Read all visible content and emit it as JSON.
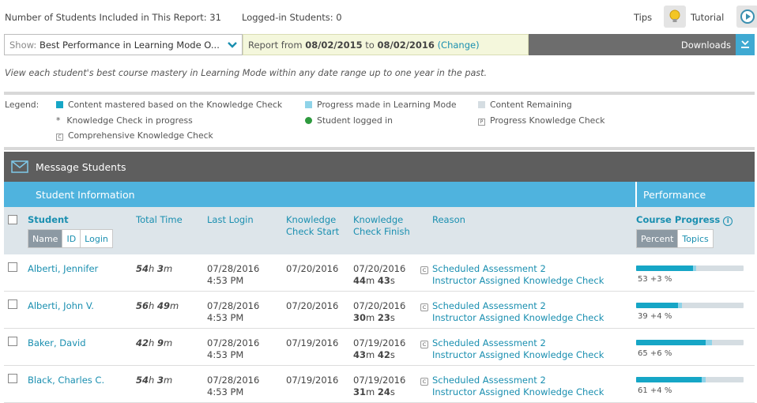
{
  "topbar": {
    "students_included": "Number of Students Included in This Report: 31",
    "logged_in": "Logged-in Students: 0",
    "tips_label": "Tips",
    "tutorial_label": "Tutorial"
  },
  "showbar": {
    "show_label": "Show:",
    "show_value": "Best Performance in Learning Mode O...",
    "report_prefix": "Report from",
    "date_from": "08/02/2015",
    "date_to_word": "to",
    "date_to": "08/02/2016",
    "change_label": "(Change)",
    "downloads_label": "Downloads"
  },
  "description": "View each student's best course mastery in Learning Mode within any date range up to one year in the past.",
  "legend": {
    "title": "Legend:",
    "mastered": "Content mastered based on the Knowledge Check",
    "progress": "Progress made in Learning Mode",
    "remaining": "Content Remaining",
    "in_progress_marker": "*",
    "in_progress": "Knowledge Check in progress",
    "logged_in": "Student logged in",
    "progress_kc_marker": "P",
    "progress_kc": "Progress Knowledge Check",
    "comprehensive_marker": "C",
    "comprehensive": "Comprehensive Knowledge Check"
  },
  "colors": {
    "mastered": "#16a6c6",
    "progress": "#8fd3e8",
    "remaining": "#d5dde2",
    "logged_in": "#2e9a3e"
  },
  "message_bar": {
    "label": "Message Students"
  },
  "header": {
    "student_info": "Student Information",
    "performance": "Performance"
  },
  "columns": {
    "student": "Student",
    "sort_name": "Name",
    "sort_id": "ID",
    "sort_login": "Login",
    "total_time": "Total Time",
    "last_login": "Last Login",
    "kc_start_1": "Knowledge",
    "kc_start_2": "Check Start",
    "kc_finish_1": "Knowledge",
    "kc_finish_2": "Check Finish",
    "reason": "Reason",
    "course_progress": "Course Progress",
    "view_percent": "Percent",
    "view_topics": "Topics"
  },
  "rows": [
    {
      "name": "Alberti, Jennifer",
      "time_h": "54",
      "time_m": "3",
      "last_login_date": "07/28/2016",
      "last_login_time": "4:53 PM",
      "kc_start": "07/20/2016",
      "kc_finish_date": "07/20/2016",
      "kc_finish_m": "44",
      "kc_finish_s": "43",
      "badge": "C",
      "reason1": "Scheduled Assessment 2",
      "reason2": "Instructor Assigned Knowledge Check",
      "progress_text": "53 +3 %",
      "mastered": 53,
      "progress": 3
    },
    {
      "name": "Alberti, John V.",
      "time_h": "56",
      "time_m": "49",
      "last_login_date": "07/28/2016",
      "last_login_time": "4:53 PM",
      "kc_start": "07/20/2016",
      "kc_finish_date": "07/20/2016",
      "kc_finish_m": "30",
      "kc_finish_s": "23",
      "badge": "C",
      "reason1": "Scheduled Assessment 2",
      "reason2": "Instructor Assigned Knowledge Check",
      "progress_text": "39 +4 %",
      "mastered": 39,
      "progress": 4
    },
    {
      "name": "Baker, David",
      "time_h": "42",
      "time_m": "9",
      "last_login_date": "07/28/2016",
      "last_login_time": "4:53 PM",
      "kc_start": "07/19/2016",
      "kc_finish_date": "07/19/2016",
      "kc_finish_m": "43",
      "kc_finish_s": "42",
      "badge": "C",
      "reason1": "Scheduled Assessment 2",
      "reason2": "Instructor Assigned Knowledge Check",
      "progress_text": "65 +6 %",
      "mastered": 65,
      "progress": 6
    },
    {
      "name": "Black, Charles C.",
      "time_h": "54",
      "time_m": "3",
      "last_login_date": "07/28/2016",
      "last_login_time": "4:53 PM",
      "kc_start": "07/19/2016",
      "kc_finish_date": "07/19/2016",
      "kc_finish_m": "31",
      "kc_finish_s": "24",
      "badge": "C",
      "reason1": "Scheduled Assessment 2",
      "reason2": "Instructor Assigned Knowledge Check",
      "progress_text": "61 +4 %",
      "mastered": 61,
      "progress": 4
    }
  ]
}
